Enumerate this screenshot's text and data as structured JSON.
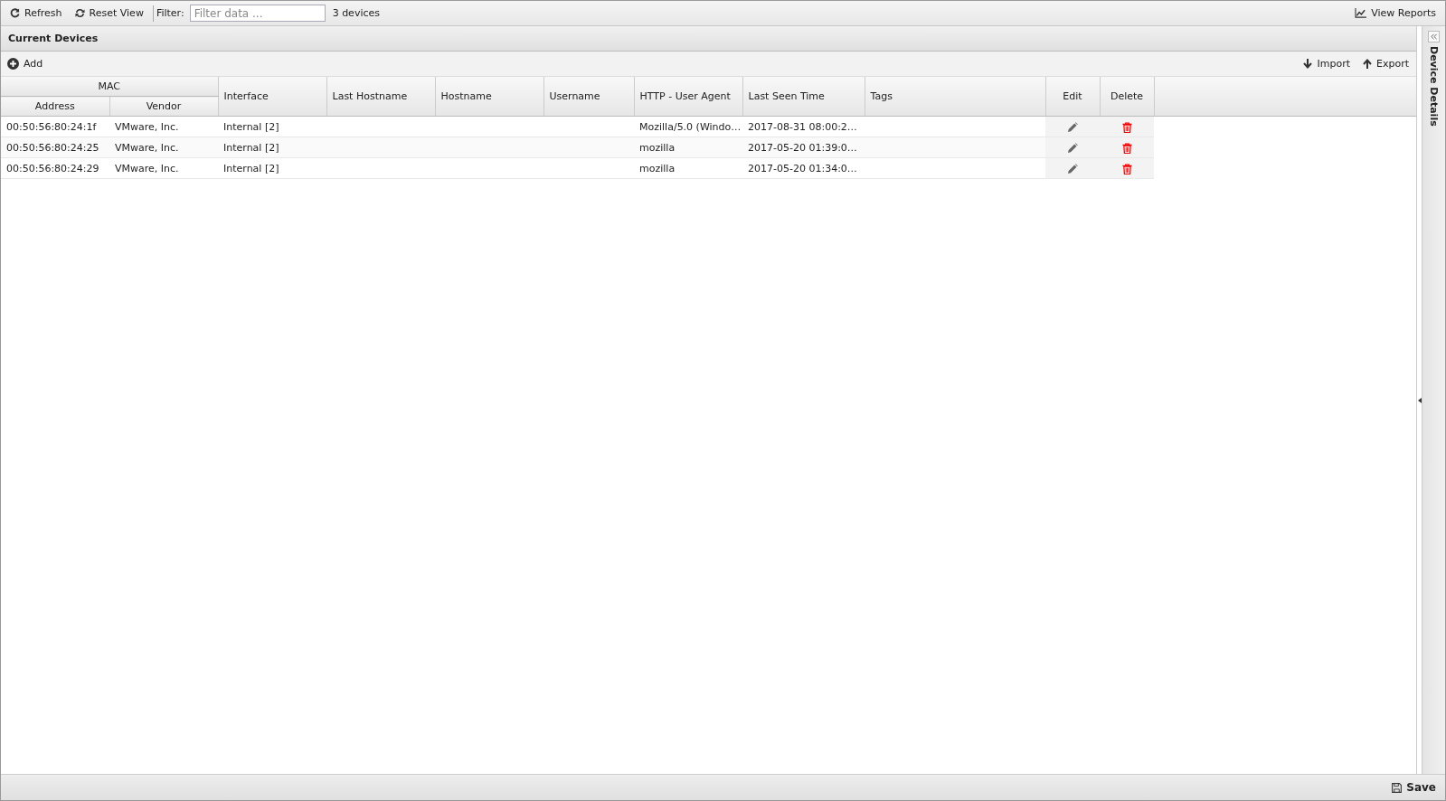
{
  "toolbar": {
    "refresh": "Refresh",
    "reset_view": "Reset View",
    "filter_label": "Filter:",
    "filter_placeholder": "Filter data ...",
    "count": "3 devices",
    "view_reports": "View Reports"
  },
  "panel": {
    "title": "Current Devices",
    "add": "Add",
    "import": "Import",
    "export": "Export"
  },
  "table": {
    "group": {
      "label": "MAC",
      "columns": [
        "Address",
        "Vendor"
      ]
    },
    "columns": [
      "Interface",
      "Last Hostname",
      "Hostname",
      "Username",
      "HTTP - User Agent",
      "Last Seen Time",
      "Tags",
      "Edit",
      "Delete"
    ],
    "rows": [
      {
        "address": "00:50:56:80:24:1f",
        "vendor": "VMware, Inc.",
        "interface": "Internal [2]",
        "user_agent": "Mozilla/5.0 (Windo…",
        "last_seen": "2017-08-31 08:00:2…"
      },
      {
        "address": "00:50:56:80:24:25",
        "vendor": "VMware, Inc.",
        "interface": "Internal [2]",
        "user_agent": "mozilla",
        "last_seen": "2017-05-20 01:39:0…"
      },
      {
        "address": "00:50:56:80:24:29",
        "vendor": "VMware, Inc.",
        "interface": "Internal [2]",
        "user_agent": "mozilla",
        "last_seen": "2017-05-20 01:34:0…"
      }
    ]
  },
  "side_panel": {
    "title": "Device Details"
  },
  "footer": {
    "save": "Save"
  }
}
